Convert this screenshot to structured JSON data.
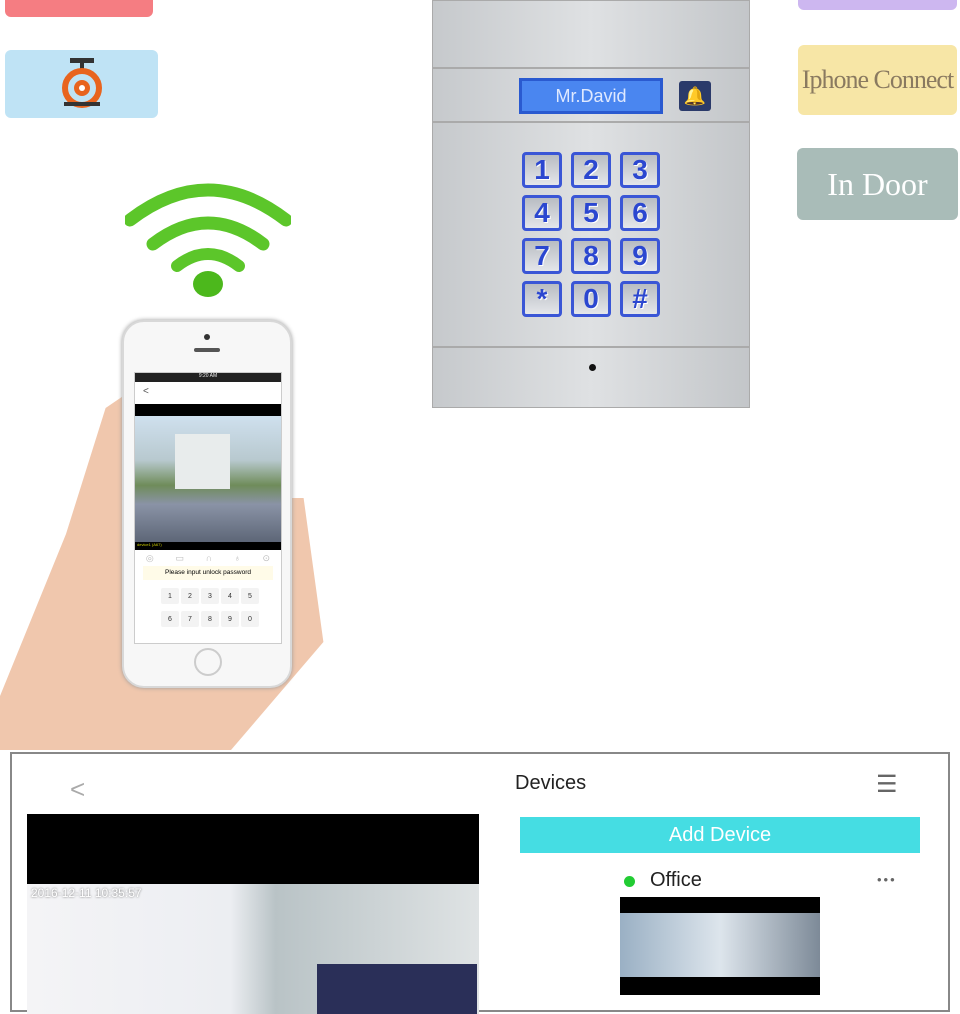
{
  "tiles": {
    "iphone_connect": "Iphone Connect",
    "in_door": "In Door"
  },
  "door_panel": {
    "display_name": "Mr.David",
    "keys": [
      "1",
      "2",
      "3",
      "4",
      "5",
      "6",
      "7",
      "8",
      "9",
      "*",
      "0",
      "#"
    ]
  },
  "phone": {
    "status_time": "9:20 AM",
    "back": "<",
    "camera_label": "device1 (A67)",
    "unlock_prompt": "Please input unlock password",
    "keys": [
      "1",
      "2",
      "3",
      "4",
      "5",
      "6",
      "7",
      "8",
      "9",
      "0"
    ]
  },
  "app": {
    "back": "<",
    "timestamp": "2016-12-11 10:35:57",
    "devices_title": "Devices",
    "add_device": "Add Device",
    "device_name": "Office",
    "device_status_color": "#22cc33",
    "more": "•••"
  },
  "colors": {
    "add_device": "#45dde3",
    "yellow_tile": "#f7e6a6",
    "gray_tile": "#a9bcb8",
    "blue_tile": "#bfe3f5",
    "pink_tile": "#f57d82",
    "purple_tile": "#cdb7f0"
  }
}
